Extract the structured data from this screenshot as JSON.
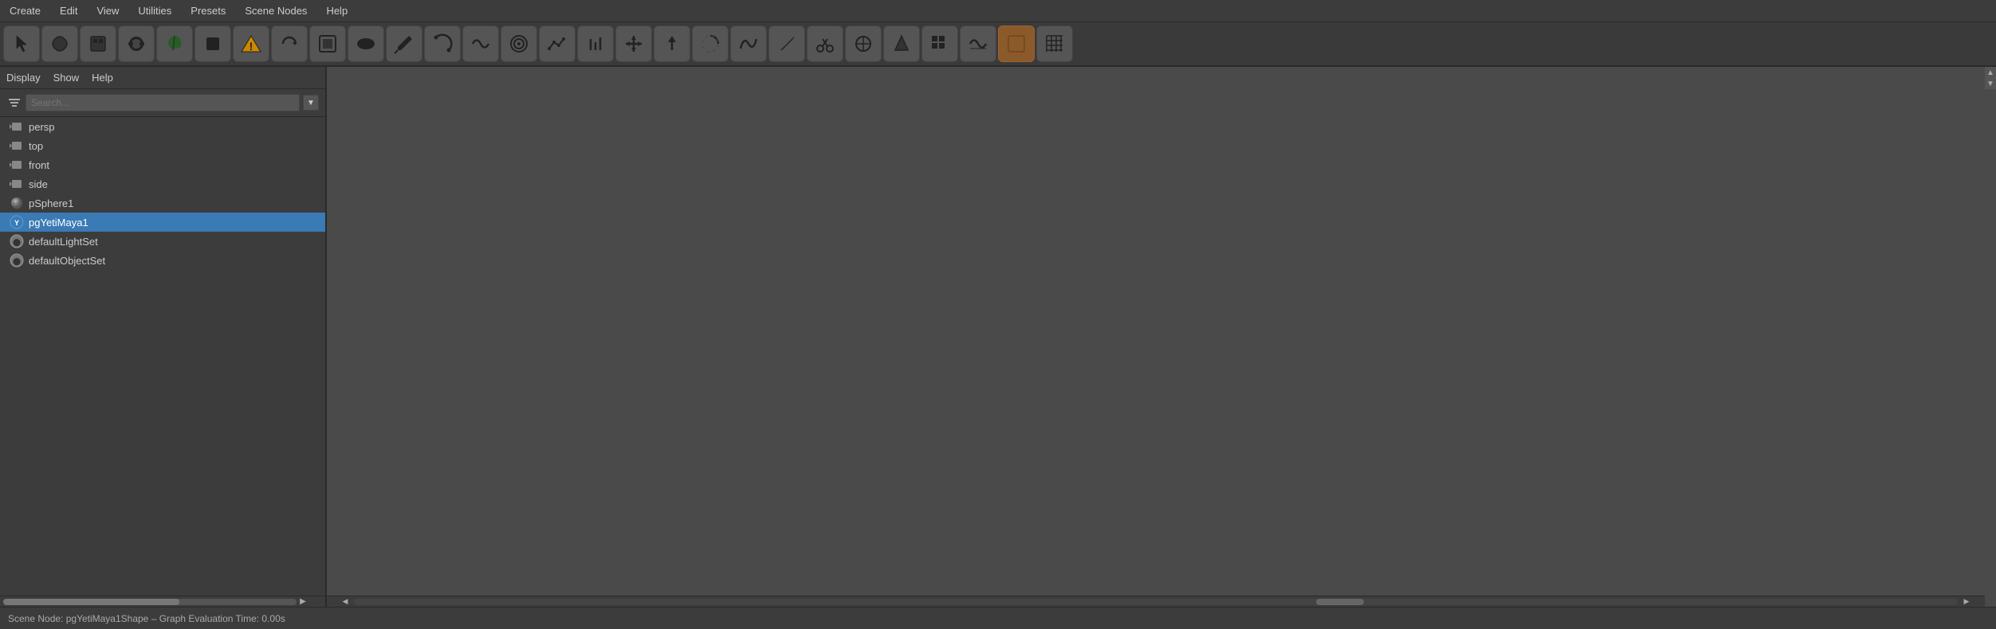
{
  "menubar": {
    "items": [
      "Create",
      "Edit",
      "View",
      "Utilities",
      "Presets",
      "Scene Nodes",
      "Help"
    ]
  },
  "toolbar": {
    "buttons": [
      {
        "name": "select-tool",
        "symbol": "↺",
        "active": false
      },
      {
        "name": "move-tool",
        "symbol": "⚙",
        "active": false
      },
      {
        "name": "box-tool",
        "symbol": "▣",
        "active": false
      },
      {
        "name": "scatter-tool",
        "symbol": "⬤",
        "active": false
      },
      {
        "name": "leaf-tool",
        "symbol": "🌿",
        "active": false
      },
      {
        "name": "bucket-tool",
        "symbol": "⬛",
        "active": false
      },
      {
        "name": "warning-tool",
        "symbol": "!",
        "active": false
      },
      {
        "name": "rotate-tool",
        "symbol": "↻",
        "active": false
      },
      {
        "name": "frame-tool",
        "symbol": "▦",
        "active": false
      },
      {
        "name": "mask-tool",
        "symbol": "⬭",
        "active": false
      },
      {
        "name": "pen-tool",
        "symbol": "✒",
        "active": false
      },
      {
        "name": "arc-tool",
        "symbol": "◷",
        "active": false
      },
      {
        "name": "wave-tool",
        "symbol": "〜",
        "active": false
      },
      {
        "name": "target-tool",
        "symbol": "◉",
        "active": false
      },
      {
        "name": "graph-tool",
        "symbol": "📈",
        "active": false
      },
      {
        "name": "counter-tool",
        "symbol": "⬆",
        "active": false
      },
      {
        "name": "move2-tool",
        "symbol": "✛",
        "active": false
      },
      {
        "name": "arrow-tool",
        "symbol": "↑",
        "active": false
      },
      {
        "name": "circle-tool",
        "symbol": "◑",
        "active": false
      },
      {
        "name": "curve-tool",
        "symbol": "∿",
        "active": false
      },
      {
        "name": "brush-tool",
        "symbol": "✏",
        "active": false
      },
      {
        "name": "scissors-tool",
        "symbol": "✂",
        "active": false
      },
      {
        "name": "move3-tool",
        "symbol": "⊕",
        "active": false
      },
      {
        "name": "cone-tool",
        "symbol": "▽",
        "active": false
      },
      {
        "name": "grid-tool",
        "symbol": "⊞",
        "active": false
      },
      {
        "name": "wave2-tool",
        "symbol": "〜",
        "active": false
      },
      {
        "name": "paint-tool",
        "symbol": "🎨",
        "active": true
      },
      {
        "name": "grid2-tool",
        "symbol": "⊞",
        "active": false
      }
    ]
  },
  "submenu": {
    "items": [
      "Display",
      "Show",
      "Help"
    ]
  },
  "search": {
    "placeholder": "Search...",
    "value": ""
  },
  "tree": {
    "items": [
      {
        "id": "persp",
        "label": "persp",
        "type": "camera",
        "selected": false,
        "indent": 0
      },
      {
        "id": "top",
        "label": "top",
        "type": "camera",
        "selected": false,
        "indent": 0
      },
      {
        "id": "front",
        "label": "front",
        "type": "camera",
        "selected": false,
        "indent": 0
      },
      {
        "id": "side",
        "label": "side",
        "type": "camera",
        "selected": false,
        "indent": 0
      },
      {
        "id": "pSphere1",
        "label": "pSphere1",
        "type": "sphere",
        "selected": false,
        "indent": 0
      },
      {
        "id": "pgYetiMaya1",
        "label": "pgYetiMaya1",
        "type": "yeti",
        "selected": true,
        "indent": 0
      },
      {
        "id": "defaultLightSet",
        "label": "defaultLightSet",
        "type": "lightset",
        "selected": false,
        "indent": 0
      },
      {
        "id": "defaultObjectSet",
        "label": "defaultObjectSet",
        "type": "lightset",
        "selected": false,
        "indent": 0
      }
    ]
  },
  "status": {
    "text": "Scene Node: pgYetiMaya1Shape – Graph Evaluation Time: 0.00s"
  }
}
